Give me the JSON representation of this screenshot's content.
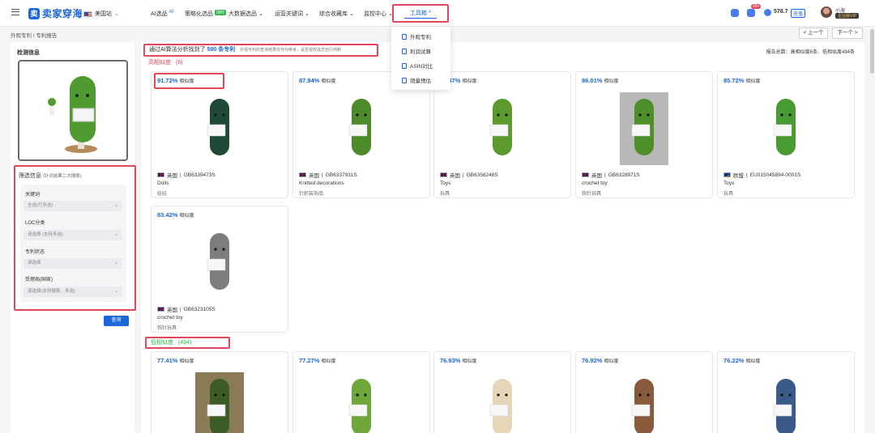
{
  "header": {
    "logo_text": "卖家穿海",
    "site": "美国站",
    "nav": [
      {
        "label": "AI选品",
        "extra": "AI"
      },
      {
        "label": "策略化选品",
        "badge": "限时"
      },
      {
        "label": "大数据选品 ⌄"
      },
      {
        "label": "运营关键词 ⌄"
      },
      {
        "label": "综合收藏库 ⌄"
      },
      {
        "label": "监控中心 ⌄"
      }
    ],
    "tools_label": "工具箱 ^",
    "notification_badge": "99+",
    "points": "578.7",
    "recharge": "充值",
    "username": "小海",
    "vip": "企业版VIP"
  },
  "dropdown": {
    "items": [
      "外观专利",
      "利润试算",
      "ASIN对比",
      "销量预估"
    ]
  },
  "breadcrumb": "外观专利 / 专利报告",
  "pager": {
    "prev": "< 上一个",
    "next": "下一个 >"
  },
  "left": {
    "detect_title": "检测信息",
    "filter_title": "筛选信息",
    "filter_subtitle": "(针对结果二次搜索)",
    "fields": [
      {
        "label": "关键词",
        "placeholder": "全选(可多选)"
      },
      {
        "label": "LOC分类",
        "placeholder": "请选择 (支持多选)"
      },
      {
        "label": "专利状态",
        "placeholder": "请选择"
      },
      {
        "label": "受理局(国家)",
        "placeholder": "请选择(支持搜索、多选)"
      }
    ],
    "query_button": "查询"
  },
  "main": {
    "banner_prefix": "通过AI算法分析找到了",
    "banner_count": "500 条专利",
    "banner_hint": "外观专利的查询结果仅作为参考，是否侵权需您自行判断",
    "report_total": "报告总数：高相似度6条、低相似度494条",
    "high_label": "高相似度",
    "high_count": "(6)",
    "low_label": "低相似度",
    "low_count": "(494)",
    "sim_word": "相似度",
    "high_cards": [
      {
        "sim": "91.72%",
        "country": "英国",
        "number": "GB6339473S",
        "title": "Dolls",
        "category": "娃娃",
        "flag": "uk",
        "color": "#1f4a35"
      },
      {
        "sim": "87.94%",
        "country": "英国",
        "number": "GB6337931S",
        "title": "Knitted decorations",
        "category": "针织装饰品",
        "flag": "uk",
        "color": "#4d8a2a"
      },
      {
        "sim": "87.47%",
        "country": "英国",
        "number": "GB6356248S",
        "title": "Toys",
        "category": "玩具",
        "flag": "uk",
        "color": "#5c9a2e"
      },
      {
        "sim": "86.01%",
        "country": "英国",
        "number": "GB6328971S",
        "title": "crochet toy",
        "category": "钩针玩具",
        "flag": "uk",
        "color": "#4f8f2a"
      },
      {
        "sim": "85.72%",
        "country": "欧盟",
        "number": "EU015045894-0001S",
        "title": "Toys",
        "category": "玩具",
        "flag": "eu",
        "color": "#4a9a33"
      },
      {
        "sim": "83.42%",
        "country": "英国",
        "number": "GB6323105S",
        "title": "crochet toy",
        "category": "钩针玩具",
        "flag": "uk",
        "color": "#7d7d7d"
      }
    ],
    "low_cards": [
      {
        "sim": "77.41%",
        "color": "#3d5c25"
      },
      {
        "sim": "77.27%",
        "color": "#6fa83a"
      },
      {
        "sim": "76.93%",
        "color": "#e6d6b8"
      },
      {
        "sim": "76.92%",
        "color": "#8a5a3c"
      },
      {
        "sim": "76.22%",
        "color": "#3a5a8a"
      }
    ]
  }
}
